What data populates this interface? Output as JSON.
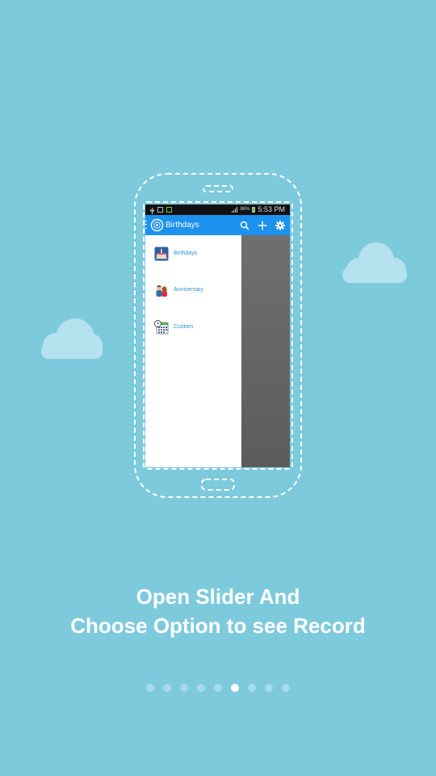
{
  "colors": {
    "background": "#7ecadd",
    "action_bar": "#1c91ee",
    "drawer_label": "#2f8fd8"
  },
  "status_bar": {
    "battery_percent": "86%",
    "time": "5:53 PM"
  },
  "action_bar": {
    "title": "Birthdays",
    "icons": [
      "menu-icon",
      "app-logo-icon",
      "search-icon",
      "add-icon",
      "settings-icon"
    ]
  },
  "drawer": {
    "items": [
      {
        "label": "Birthdays",
        "icon": "birthday-cake-icon"
      },
      {
        "label": "Anniversary",
        "icon": "couple-icon"
      },
      {
        "label": "Custom",
        "icon": "calendar-clock-icon"
      }
    ]
  },
  "headline": {
    "line1": "Open Slider And",
    "line2": "Choose Option to see Record"
  },
  "pager": {
    "total": 9,
    "active_index": 5
  }
}
